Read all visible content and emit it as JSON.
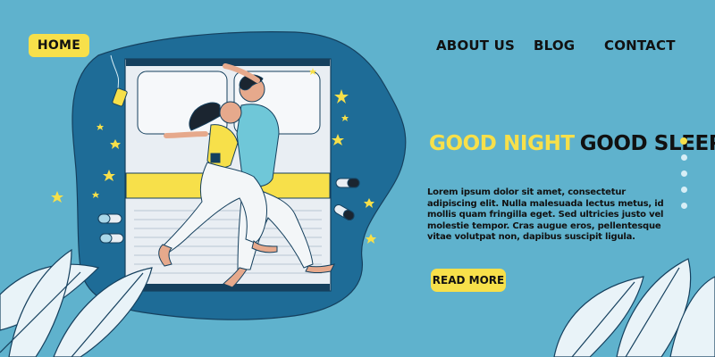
{
  "nav": {
    "home": "HOME",
    "about": "ABOUT US",
    "blog": "BLOG",
    "contact": "CONTACT"
  },
  "hero": {
    "headline_part1": "GOOD NIGHT",
    "headline_part2": "GOOD SLEEP",
    "body": "Lorem ipsum dolor sit amet, consectetur adipiscing elit. Nulla malesuada lectus metus, id mollis quam fringilla eget. Sed ultricies justo vel molestie tempor. Cras augue eros, pellentesque vitae volutpat non, dapibus suscipit ligula.",
    "cta": "READ MORE"
  },
  "slider": {
    "count": 5,
    "active_index": 0
  },
  "colors": {
    "background": "#5fb2cd",
    "blob": "#1e6c97",
    "accent_yellow": "#f7e04a",
    "text_dark": "#111111",
    "dot_inactive": "#d7eef6"
  },
  "illustration": {
    "icons": [
      "couple-sleeping-illustration",
      "bed-icon",
      "star-icon",
      "pill-icon",
      "moon-blob-shape",
      "leaf-icon",
      "earphones-icon"
    ]
  }
}
